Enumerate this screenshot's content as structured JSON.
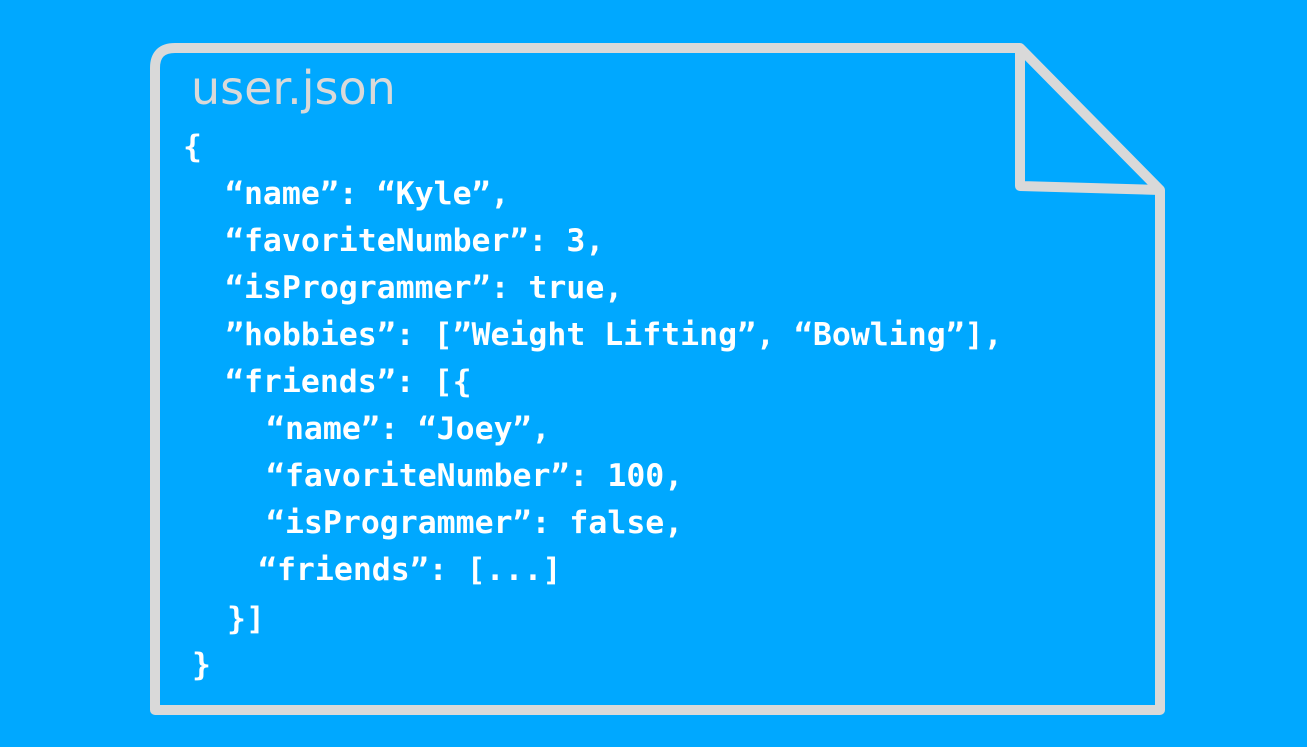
{
  "file": {
    "title": "user.json",
    "outline_color": "#d9d9d9",
    "background_color": "#00a8ff",
    "code_color": "#ffffff",
    "code_lines": [
      "{",
      "“name”: “Kyle”,",
      "“favoriteNumber”: 3,",
      "“isProgrammer”: true,",
      "”hobbies”: [”Weight Lifting”, “Bowling”],",
      "“friends”: [{",
      "“name”: “Joey”,",
      "“favoriteNumber”: 100,",
      "“isProgrammer”: false,",
      "“friends”: [...]",
      "}]",
      "}"
    ]
  }
}
